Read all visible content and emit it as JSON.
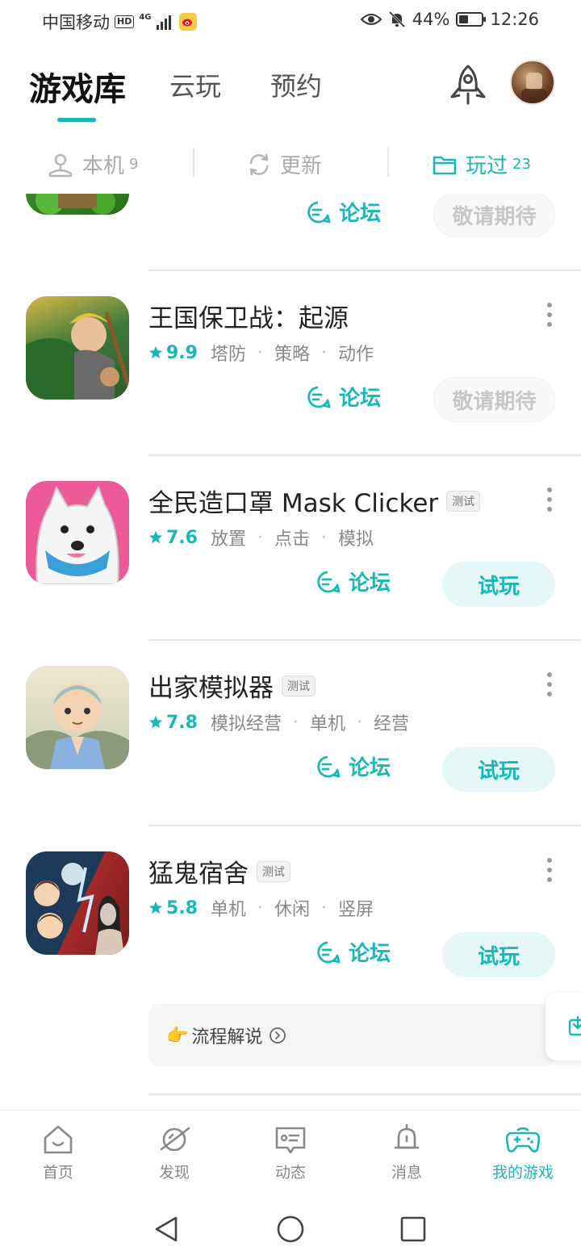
{
  "status_bar": {
    "carrier": "中国移动",
    "hd": "HD",
    "network": "4G",
    "battery": "44%",
    "battery_level": 0.44,
    "time": "12:26"
  },
  "header": {
    "tabs": [
      {
        "label": "游戏库",
        "active": true
      },
      {
        "label": "云玩",
        "active": false
      },
      {
        "label": "预约",
        "active": false
      }
    ]
  },
  "sub_tabs": [
    {
      "label": "本机",
      "count": "9",
      "icon": "download-icon",
      "active": false
    },
    {
      "label": "更新",
      "count": "",
      "icon": "refresh-icon",
      "active": false
    },
    {
      "label": "玩过",
      "count": "23",
      "icon": "folder-icon",
      "active": true
    }
  ],
  "partial_item": {
    "forum": "论坛",
    "action": "敬请期待"
  },
  "games": [
    {
      "title": "王国保卫战：起源",
      "badge": "",
      "score": "9.9",
      "tags": [
        "塔防",
        "策略",
        "动作"
      ],
      "forum": "论坛",
      "action": "敬请期待",
      "action_type": "wait"
    },
    {
      "title": "全民造口罩 Mask Clicker",
      "badge": "测试",
      "score": "7.6",
      "tags": [
        "放置",
        "点击",
        "模拟"
      ],
      "forum": "论坛",
      "action": "试玩",
      "action_type": "try"
    },
    {
      "title": "出家模拟器",
      "badge": "测试",
      "score": "7.8",
      "tags": [
        "模拟经营",
        "单机",
        "经营"
      ],
      "forum": "论坛",
      "action": "试玩",
      "action_type": "try"
    },
    {
      "title": "猛鬼宿舍",
      "badge": "测试",
      "score": "5.8",
      "tags": [
        "单机",
        "休闲",
        "竖屏"
      ],
      "forum": "论坛",
      "action": "试玩",
      "action_type": "try"
    }
  ],
  "walkthrough": {
    "emoji": "👉",
    "label": "流程解说"
  },
  "bottom_nav": [
    {
      "label": "首页",
      "icon": "home-icon",
      "active": false
    },
    {
      "label": "发现",
      "icon": "planet-icon",
      "active": false
    },
    {
      "label": "动态",
      "icon": "chat-icon",
      "active": false
    },
    {
      "label": "消息",
      "icon": "bell-icon",
      "active": false
    },
    {
      "label": "我的游戏",
      "icon": "gamepad-icon",
      "active": true
    }
  ],
  "colors": {
    "accent": "#19b8b8",
    "accent_light": "#e6f7f7",
    "muted": "#888888"
  }
}
